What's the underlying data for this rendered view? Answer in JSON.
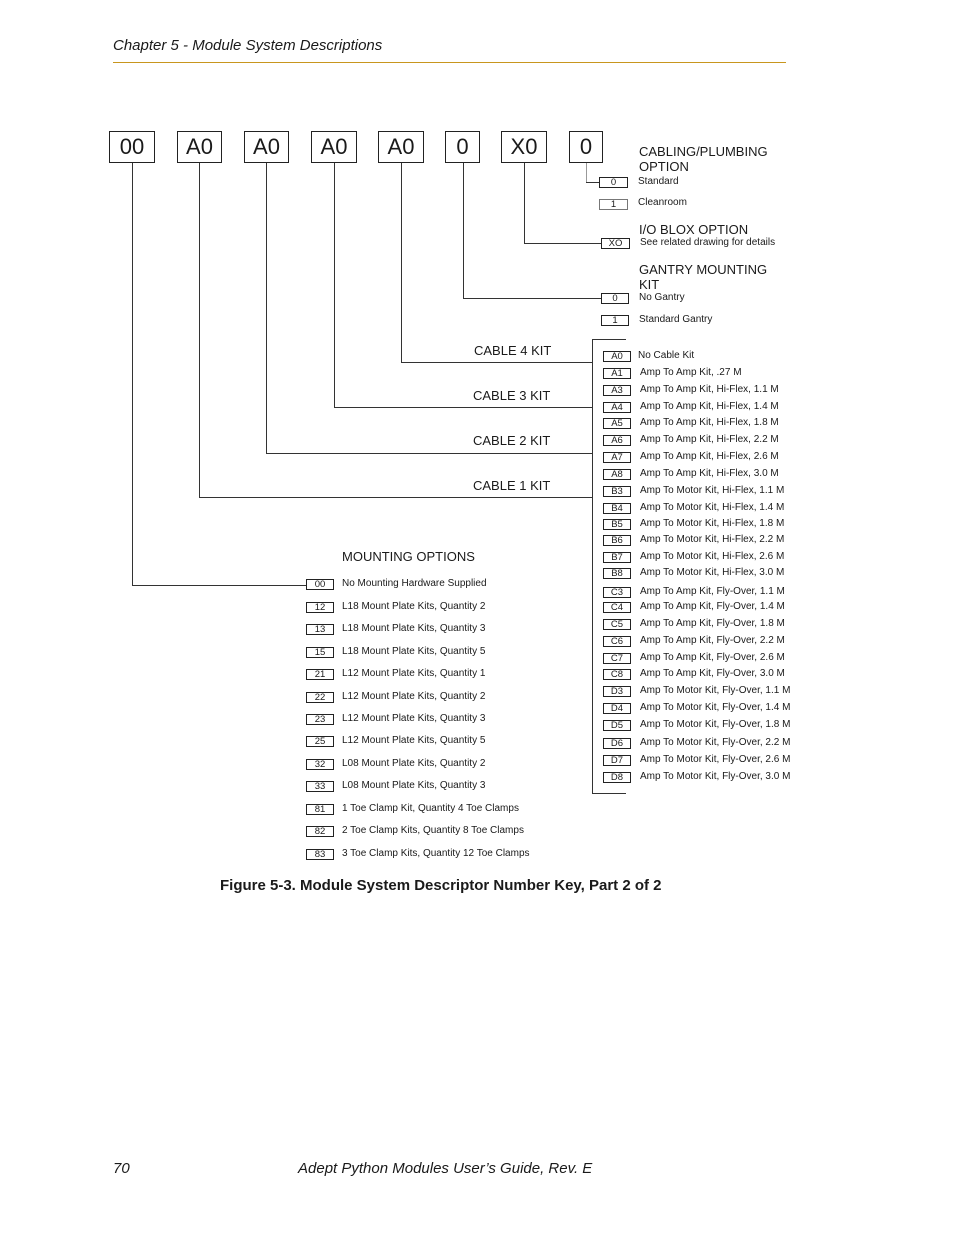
{
  "header": {
    "chapter": "Chapter 5 - Module System Descriptions"
  },
  "descriptor_boxes": [
    "00",
    "A0",
    "A0",
    "A0",
    "A0",
    "0",
    "X0",
    "0"
  ],
  "cabling": {
    "heading": "CABLING/PLUMBING OPTION",
    "items": [
      {
        "code": "0",
        "desc": "Standard"
      },
      {
        "code": "1",
        "desc": "Cleanroom"
      }
    ]
  },
  "io_blox": {
    "heading": "I/O BLOX OPTION",
    "items": [
      {
        "code": "XO",
        "desc": "See related drawing for details"
      }
    ]
  },
  "gantry": {
    "heading": "GANTRY MOUNTING KIT",
    "items": [
      {
        "code": "0",
        "desc": "No Gantry"
      },
      {
        "code": "1",
        "desc": "Standard Gantry"
      }
    ]
  },
  "cable_labels": [
    "CABLE 4  KIT",
    "CABLE 3  KIT",
    "CABLE 2  KIT",
    "CABLE 1  KIT"
  ],
  "cable_kits": [
    {
      "code": "A0",
      "desc": "No Cable Kit"
    },
    {
      "code": "A1",
      "desc": "Amp To Amp Kit, .27 M"
    },
    {
      "code": "A3",
      "desc": "Amp To Amp Kit, Hi-Flex, 1.1 M"
    },
    {
      "code": "A4",
      "desc": "Amp To Amp Kit, Hi-Flex, 1.4 M"
    },
    {
      "code": "A5",
      "desc": "Amp To Amp Kit, Hi-Flex, 1.8 M"
    },
    {
      "code": "A6",
      "desc": "Amp To Amp Kit, Hi-Flex, 2.2 M"
    },
    {
      "code": "A7",
      "desc": "Amp To Amp Kit, Hi-Flex, 2.6 M"
    },
    {
      "code": "A8",
      "desc": "Amp To Amp Kit, Hi-Flex, 3.0 M"
    },
    {
      "code": "B3",
      "desc": "Amp To Motor Kit, Hi-Flex, 1.1 M"
    },
    {
      "code": "B4",
      "desc": "Amp To Motor Kit, Hi-Flex, 1.4 M"
    },
    {
      "code": "B5",
      "desc": "Amp To Motor Kit, Hi-Flex, 1.8 M"
    },
    {
      "code": "B6",
      "desc": "Amp To Motor Kit, Hi-Flex, 2.2 M"
    },
    {
      "code": "B7",
      "desc": "Amp To Motor Kit, Hi-Flex, 2.6 M"
    },
    {
      "code": "B8",
      "desc": "Amp To Motor Kit, Hi-Flex, 3.0 M"
    },
    {
      "code": "C3",
      "desc": "Amp To Amp Kit, Fly-Over, 1.1 M"
    },
    {
      "code": "C4",
      "desc": "Amp To Amp Kit, Fly-Over, 1.4 M"
    },
    {
      "code": "C5",
      "desc": "Amp To Amp Kit, Fly-Over, 1.8 M"
    },
    {
      "code": "C6",
      "desc": "Amp To Amp Kit, Fly-Over, 2.2 M"
    },
    {
      "code": "C7",
      "desc": "Amp To Amp Kit, Fly-Over, 2.6 M"
    },
    {
      "code": "C8",
      "desc": "Amp To Amp Kit, Fly-Over, 3.0 M"
    },
    {
      "code": "D3",
      "desc": "Amp To Motor Kit, Fly-Over, 1.1 M"
    },
    {
      "code": "D4",
      "desc": "Amp To Motor Kit, Fly-Over, 1.4 M"
    },
    {
      "code": "D5",
      "desc": "Amp To Motor Kit, Fly-Over, 1.8 M"
    },
    {
      "code": "D6",
      "desc": "Amp To Motor Kit, Fly-Over, 2.2 M"
    },
    {
      "code": "D7",
      "desc": "Amp To Motor Kit, Fly-Over, 2.6 M"
    },
    {
      "code": "D8",
      "desc": "Amp To Motor Kit, Fly-Over, 3.0 M"
    }
  ],
  "mounting": {
    "heading": "MOUNTING  OPTIONS",
    "items": [
      {
        "code": "00",
        "desc": "No Mounting Hardware Supplied"
      },
      {
        "code": "12",
        "desc": "L18 Mount Plate Kits, Quantity 2"
      },
      {
        "code": "13",
        "desc": "L18 Mount Plate Kits, Quantity 3"
      },
      {
        "code": "15",
        "desc": "L18 Mount Plate Kits, Quantity 5"
      },
      {
        "code": "21",
        "desc": "L12 Mount Plate Kits, Quantity 1"
      },
      {
        "code": "22",
        "desc": "L12 Mount Plate Kits, Quantity 2"
      },
      {
        "code": "23",
        "desc": "L12 Mount Plate Kits, Quantity 3"
      },
      {
        "code": "25",
        "desc": "L12 Mount Plate Kits, Quantity 5"
      },
      {
        "code": "32",
        "desc": "L08 Mount Plate Kits, Quantity 2"
      },
      {
        "code": "33",
        "desc": "L08 Mount Plate Kits, Quantity 3"
      },
      {
        "code": "81",
        "desc": "1 Toe Clamp Kit, Quantity 4 Toe Clamps"
      },
      {
        "code": "82",
        "desc": "2 Toe Clamp Kits, Quantity 8 Toe Clamps"
      },
      {
        "code": "83",
        "desc": "3 Toe Clamp Kits, Quantity 12 Toe Clamps"
      }
    ]
  },
  "figure_caption": "Figure 5-3. Module System Descriptor Number Key, Part 2 of 2",
  "footer": {
    "page_number": "70",
    "title": "Adept Python Modules User’s Guide, Rev. E"
  }
}
